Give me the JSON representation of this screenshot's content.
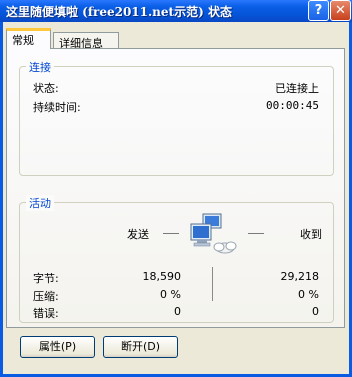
{
  "window": {
    "title": "这里随便填啦 (free2011.net示范) 状态",
    "help_label": "?",
    "close_label": "✕"
  },
  "tabs": [
    {
      "label": "常规",
      "active": true
    },
    {
      "label": "详细信息",
      "active": false
    }
  ],
  "connection": {
    "group_title": "连接",
    "status_label": "状态:",
    "status_value": "已连接上",
    "duration_label": "持续时间:",
    "duration_value": "00:00:45"
  },
  "activity": {
    "group_title": "活动",
    "sent_label": "发送",
    "received_label": "收到",
    "rows": [
      {
        "label": "字节:",
        "sent": "18,590",
        "received": "29,218"
      },
      {
        "label": "压缩:",
        "sent": "0 %",
        "received": "0 %"
      },
      {
        "label": "错误:",
        "sent": "0",
        "received": "0"
      }
    ],
    "icon": "network-computers-icon"
  },
  "buttons": {
    "properties": "属性(P)",
    "disconnect": "断开(D)"
  },
  "colors": {
    "titlebar": "#0a5fe6",
    "group_title": "#0046d5",
    "face": "#ece9d8"
  }
}
